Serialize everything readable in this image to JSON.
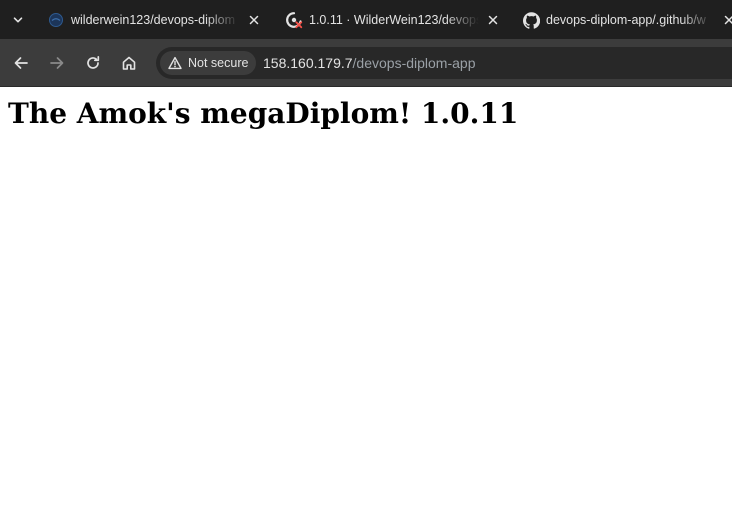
{
  "browser": {
    "tabs": [
      {
        "title": "wilderwein123/devops-diplom",
        "favicon": "tab-page-icon"
      },
      {
        "title": "1.0.11 · WilderWein123/devops",
        "favicon": "github-actions-failed-icon"
      },
      {
        "title": "devops-diplom-app/.github/w",
        "favicon": "github-icon"
      }
    ],
    "address_bar": {
      "security_label": "Not secure",
      "url_host": "158.160.179.7",
      "url_path": "/devops-diplom-app"
    }
  },
  "page": {
    "heading": "The Amok's megaDiplom! 1.0.11"
  },
  "colors": {
    "tabstrip_bg": "#1f1f1f",
    "toolbar_bg": "#3c3c3c",
    "omnibox_bg": "#282828",
    "text_light": "#e3e3e3",
    "url_path": "#9aa0a6",
    "page_bg": "#ffffff"
  }
}
